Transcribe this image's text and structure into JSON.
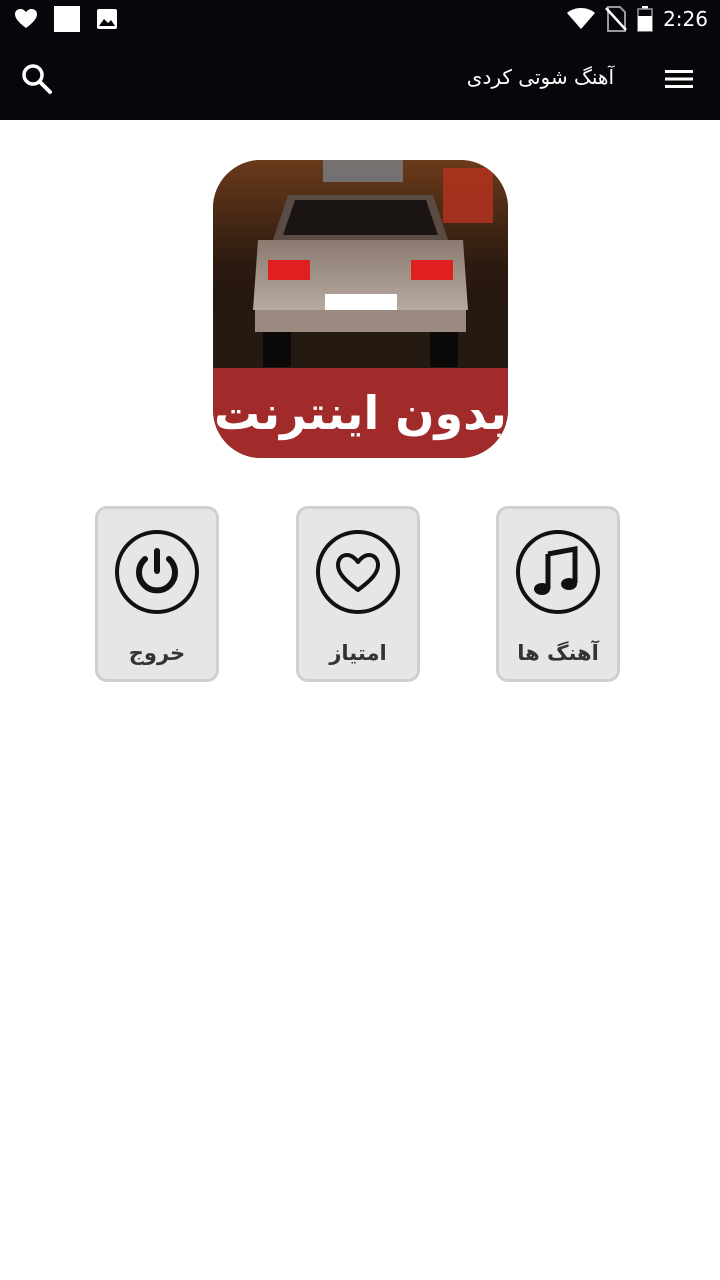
{
  "status_bar": {
    "time": "2:26",
    "left_icons": [
      "heart-icon",
      "square-icon",
      "image-icon"
    ],
    "right_icons": [
      "wifi-icon",
      "no-sim-icon",
      "battery-icon"
    ]
  },
  "app_bar": {
    "title": "آهنگ شوتی کردی",
    "menu_icon": "hamburger-menu-icon",
    "search_icon": "search-icon",
    "background": "#07070b"
  },
  "logo": {
    "banner_text": "بدون اینترنت",
    "banner_color": "#a12a2a"
  },
  "tiles": [
    {
      "label": "آهنگ ها",
      "icon": "music-note-icon"
    },
    {
      "label": "امتیاز",
      "icon": "heart-icon"
    },
    {
      "label": "خروج",
      "icon": "power-icon"
    }
  ]
}
